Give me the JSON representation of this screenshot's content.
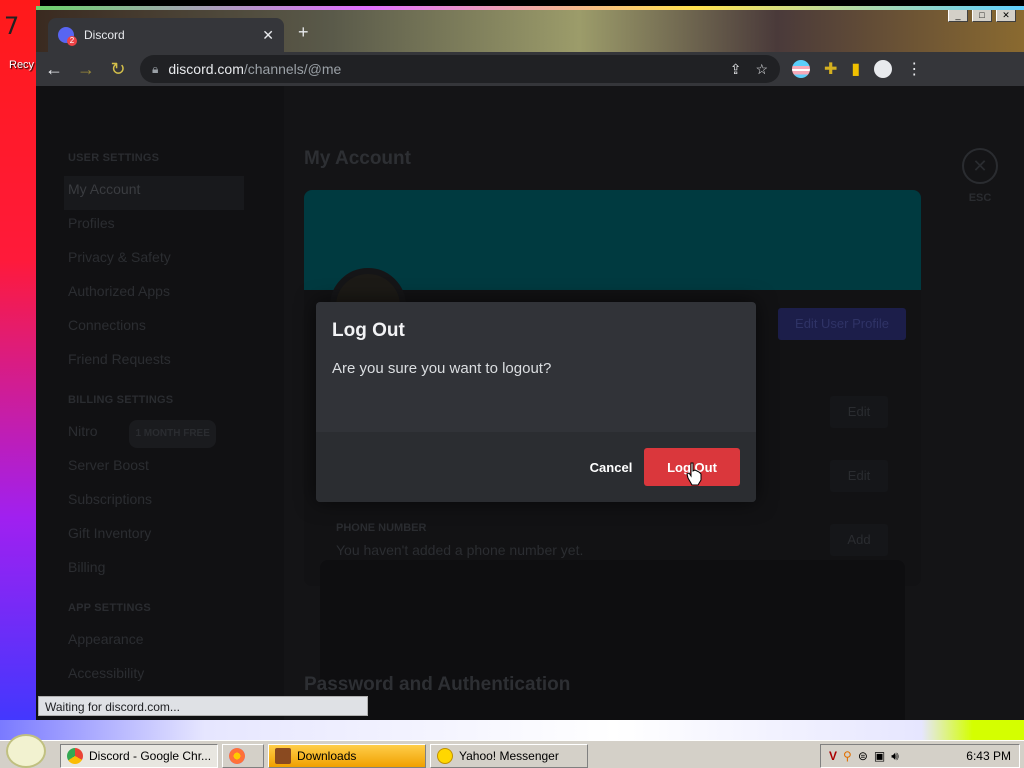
{
  "desktop": {
    "number": "7",
    "icon_label": "Recy"
  },
  "browser": {
    "tab_title": "Discord",
    "tab_close": "✕",
    "url_domain": "discord.com",
    "url_path": "/channels/@me",
    "status_text": "Waiting for discord.com..."
  },
  "sidebar": {
    "user_settings_header": "USER SETTINGS",
    "user_items": [
      "My Account",
      "Profiles",
      "Privacy & Safety",
      "Authorized Apps",
      "Connections",
      "Friend Requests"
    ],
    "billing_header": "BILLING SETTINGS",
    "nitro_label": "Nitro",
    "nitro_badge": "1 MONTH FREE",
    "billing_items": [
      "Server Boost",
      "Subscriptions",
      "Gift Inventory",
      "Billing"
    ],
    "app_header": "APP SETTINGS",
    "app_items": [
      "Appearance",
      "Accessibility"
    ]
  },
  "main": {
    "title": "My Account",
    "edit_profile": "Edit User Profile",
    "edit_1": "Edit",
    "edit_2": "Edit",
    "add": "Add",
    "phone_label": "PHONE NUMBER",
    "phone_value": "You haven't added a phone number yet.",
    "password_heading": "Password and Authentication",
    "esc_label": "ESC"
  },
  "modal": {
    "title": "Log Out",
    "message": "Are you sure you want to logout?",
    "cancel": "Cancel",
    "confirm": "Log Out",
    "confirm_color": "#da373c"
  },
  "taskbar": {
    "items": [
      "Discord - Google Chr...",
      "",
      "Downloads",
      "Yahoo! Messenger"
    ],
    "clock": "6:43 PM"
  }
}
